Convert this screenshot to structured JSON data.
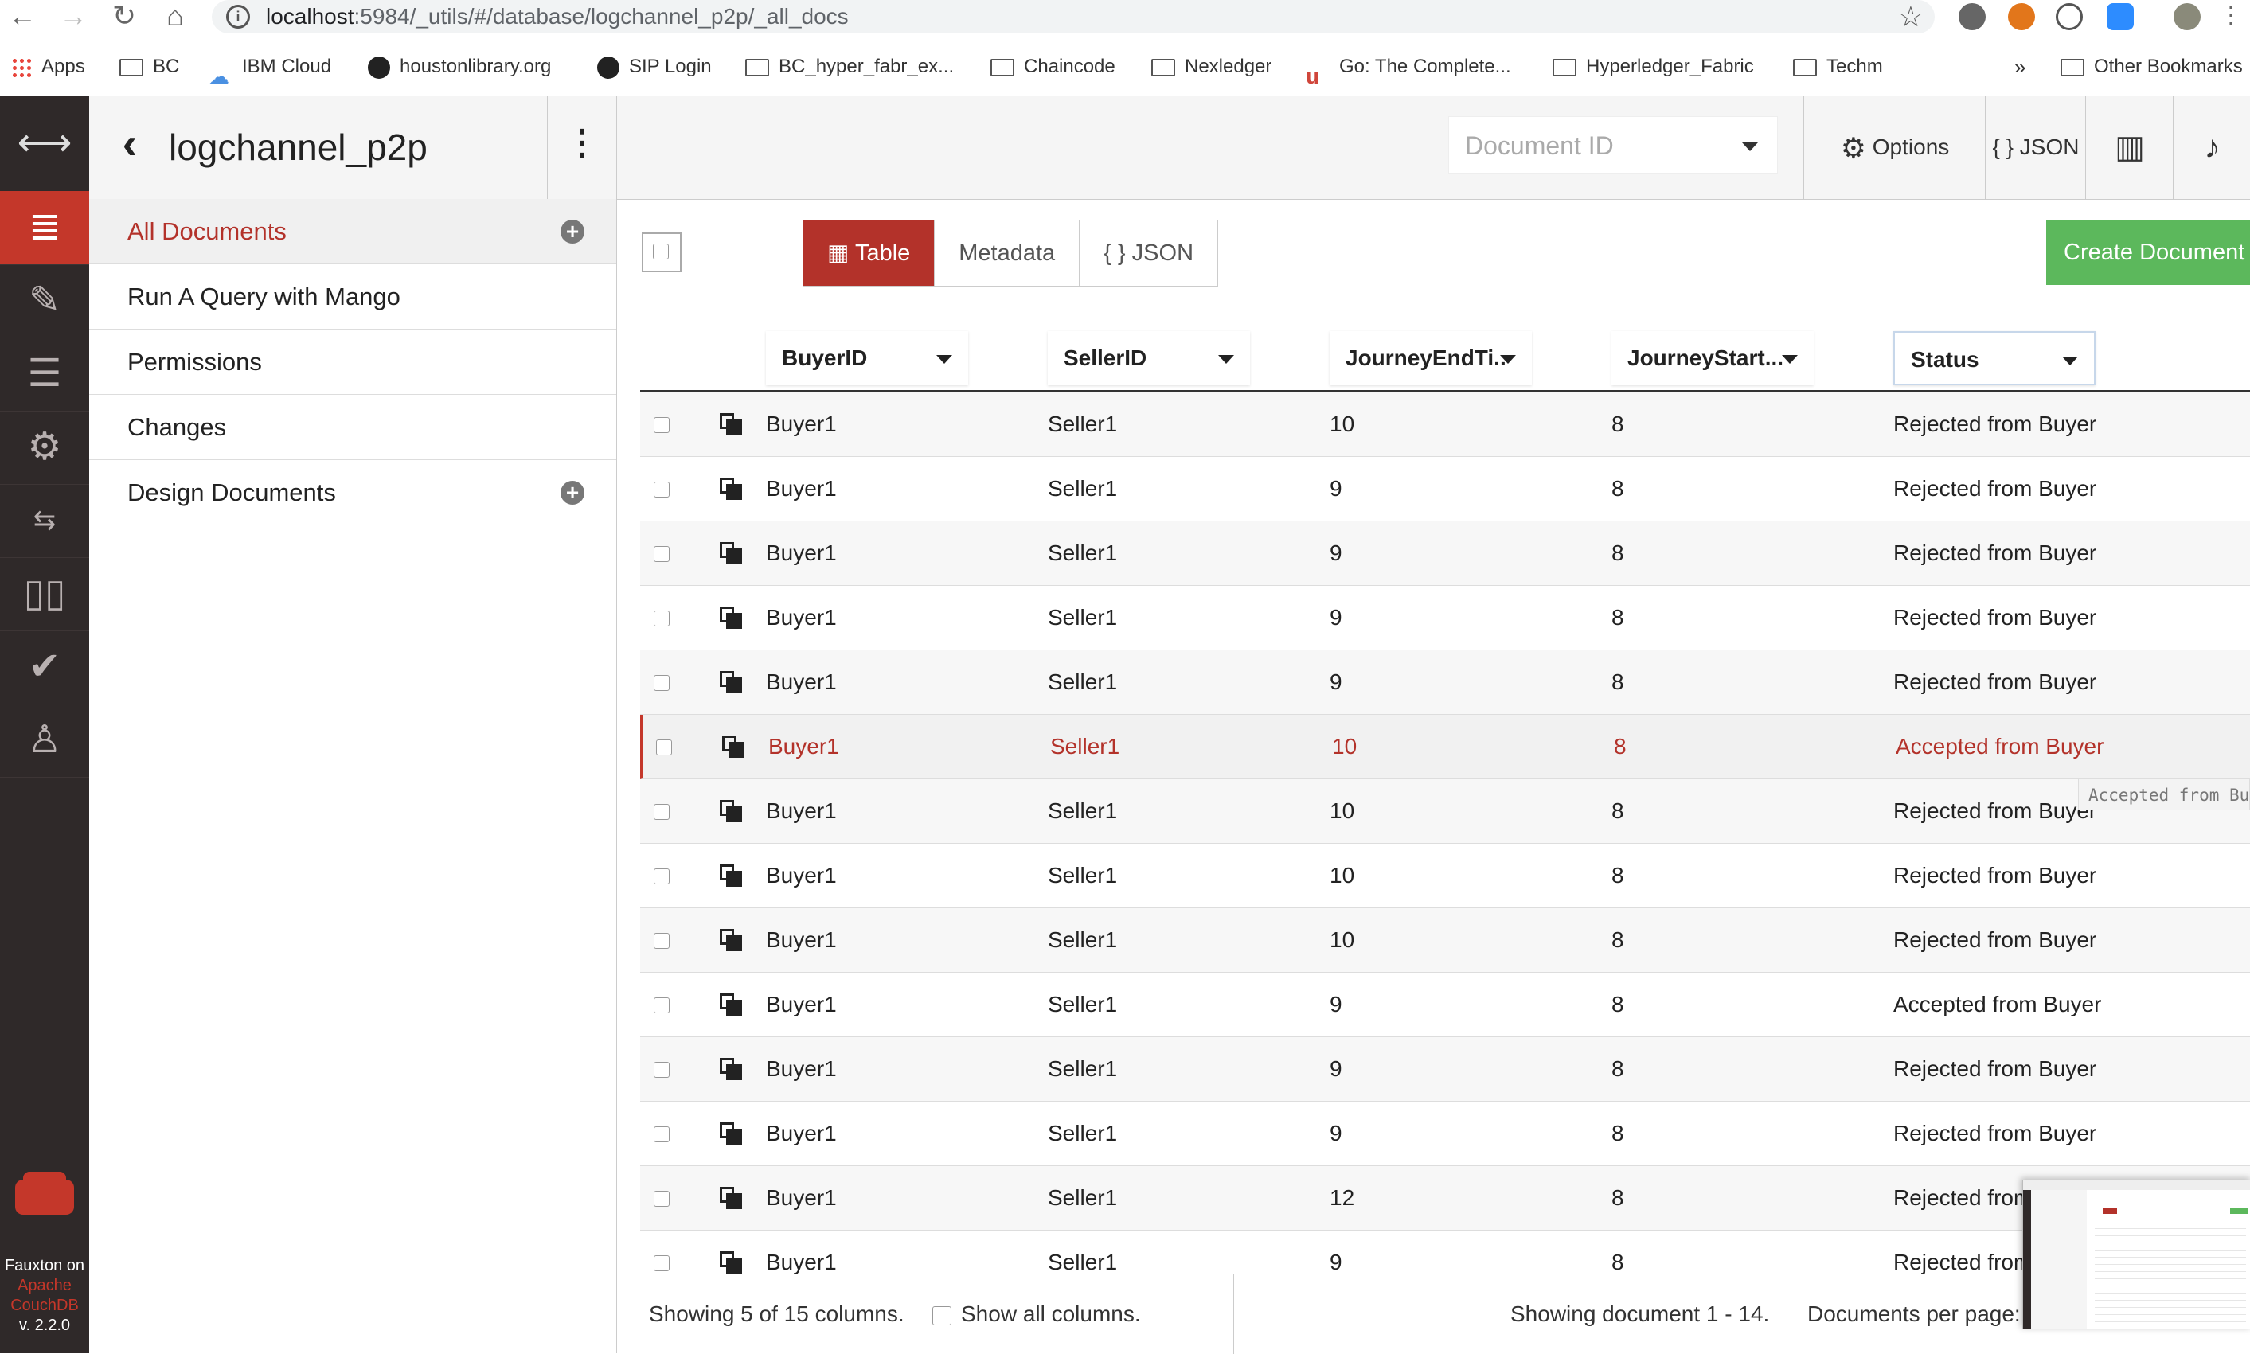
{
  "browser": {
    "url_host": "localhost",
    "url_rest": ":5984/_utils/#/database/logchannel_p2p/_all_docs",
    "bookmarks": [
      {
        "label": "Apps",
        "icon": "apps-grid-icon"
      },
      {
        "label": "BC",
        "icon": "folder-icon"
      },
      {
        "label": "IBM Cloud",
        "icon": "cloud-icon"
      },
      {
        "label": "houstonlibrary.org",
        "icon": "site-icon"
      },
      {
        "label": "SIP Login",
        "icon": "site-icon"
      },
      {
        "label": "BC_hyper_fabr_ex...",
        "icon": "folder-icon"
      },
      {
        "label": "Chaincode",
        "icon": "folder-icon"
      },
      {
        "label": "Nexledger",
        "icon": "folder-icon"
      },
      {
        "label": "Go: The Complete...",
        "icon": "udemy-icon"
      },
      {
        "label": "Hyperledger_Fabric",
        "icon": "folder-icon"
      },
      {
        "label": "Techm",
        "icon": "folder-icon"
      }
    ],
    "overflow": "»",
    "other_bookmarks": "Other Bookmarks"
  },
  "sidebar": {
    "db_name": "logchannel_p2p",
    "items": [
      {
        "label": "All Documents",
        "active": true,
        "plus": true
      },
      {
        "label": "Run A Query with Mango"
      },
      {
        "label": "Permissions"
      },
      {
        "label": "Changes"
      },
      {
        "label": "Design Documents",
        "plus": true
      }
    ]
  },
  "rail": {
    "icons": [
      "expand-arrows-icon",
      "database-icon",
      "wrench-icon",
      "list-icon",
      "gear-icon",
      "replication-icon",
      "book-icon",
      "check-circle-icon",
      "user-icon"
    ],
    "footer": {
      "line1": "Fauxton on",
      "line2": "Apache",
      "line3": "CouchDB",
      "version": "v. 2.2.0"
    }
  },
  "header": {
    "doc_id_placeholder": "Document ID",
    "options_label": "Options",
    "json_label": "{ } JSON"
  },
  "toolbar": {
    "views": [
      "Table",
      "Metadata",
      "{ } JSON"
    ],
    "active_view": "Table",
    "create_label": "Create Document"
  },
  "table": {
    "columns": [
      "BuyerID",
      "SellerID",
      "JourneyEndTi..",
      "JourneyStart...",
      "Status"
    ],
    "rows": [
      [
        "Buyer1",
        "Seller1",
        "10",
        "8",
        "Rejected from Buyer"
      ],
      [
        "Buyer1",
        "Seller1",
        "9",
        "8",
        "Rejected from Buyer"
      ],
      [
        "Buyer1",
        "Seller1",
        "9",
        "8",
        "Rejected from Buyer"
      ],
      [
        "Buyer1",
        "Seller1",
        "9",
        "8",
        "Rejected from Buyer"
      ],
      [
        "Buyer1",
        "Seller1",
        "9",
        "8",
        "Rejected from Buyer"
      ],
      [
        "Buyer1",
        "Seller1",
        "10",
        "8",
        "Accepted from Buyer"
      ],
      [
        "Buyer1",
        "Seller1",
        "10",
        "8",
        "Rejected from Buyer"
      ],
      [
        "Buyer1",
        "Seller1",
        "10",
        "8",
        "Rejected from Buyer"
      ],
      [
        "Buyer1",
        "Seller1",
        "10",
        "8",
        "Rejected from Buyer"
      ],
      [
        "Buyer1",
        "Seller1",
        "9",
        "8",
        "Accepted from Buyer"
      ],
      [
        "Buyer1",
        "Seller1",
        "9",
        "8",
        "Rejected from Buyer"
      ],
      [
        "Buyer1",
        "Seller1",
        "9",
        "8",
        "Rejected from Buyer"
      ],
      [
        "Buyer1",
        "Seller1",
        "12",
        "8",
        "Rejected from"
      ],
      [
        "Buyer1",
        "Seller1",
        "9",
        "8",
        "Rejected from"
      ]
    ],
    "highlighted_row": 5,
    "tooltip": "Accepted  from Buy"
  },
  "footer": {
    "columns_info": "Showing 5 of 15 columns.",
    "show_all": "Show all columns.",
    "paging": "Showing document 1 - 14.",
    "per_page": "Documents per page:"
  },
  "colors": {
    "accent": "#b3322a",
    "rail": "#2f2929",
    "create": "#5cb85c"
  }
}
